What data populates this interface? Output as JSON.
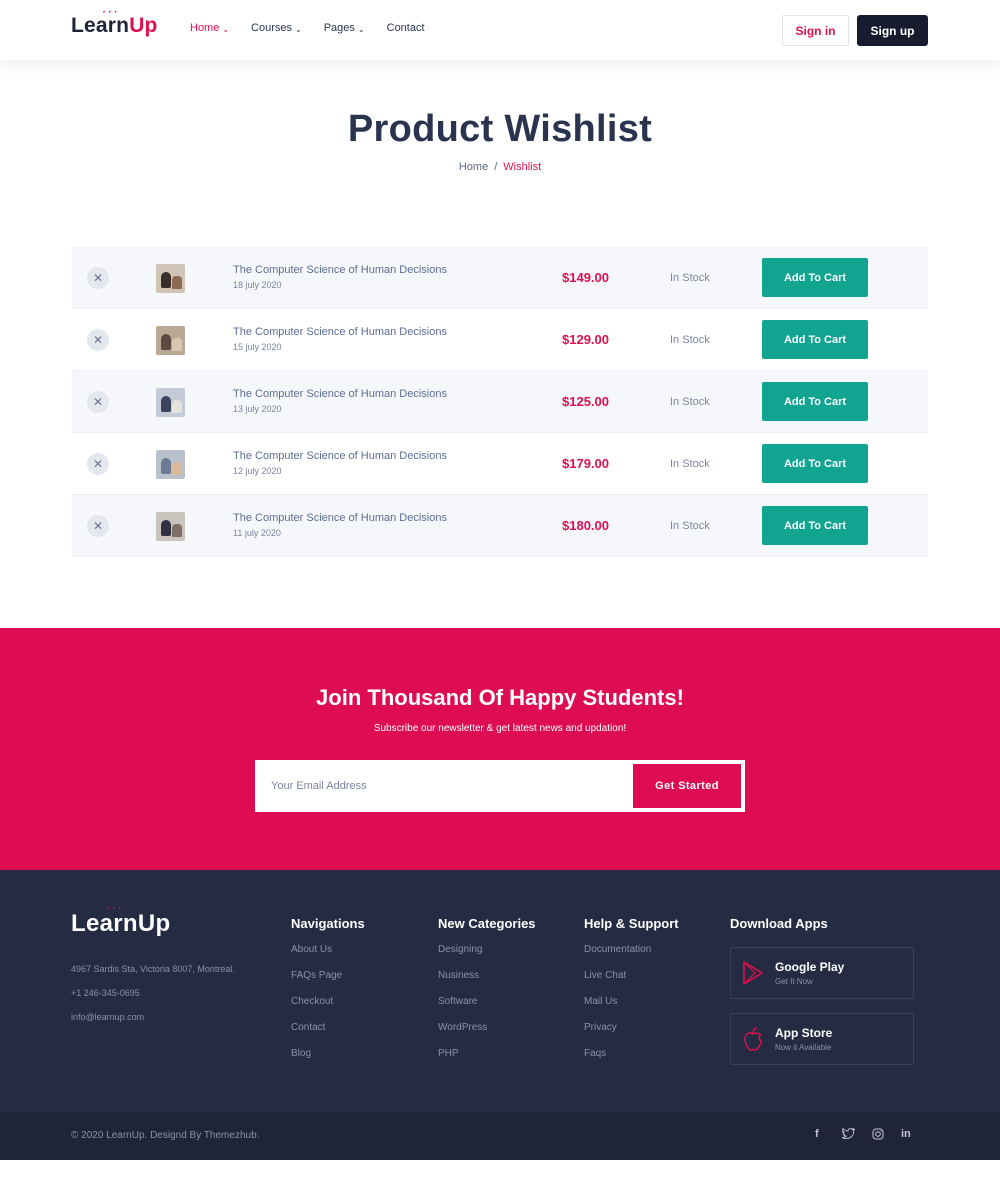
{
  "brand": {
    "name_part1": "Learn",
    "name_part2": "Up",
    "accent": "#e0104f"
  },
  "nav": {
    "items": [
      {
        "label": "Home",
        "has_dropdown": true,
        "active": true
      },
      {
        "label": "Courses",
        "has_dropdown": true,
        "active": false
      },
      {
        "label": "Pages",
        "has_dropdown": true,
        "active": false
      },
      {
        "label": "Contact",
        "has_dropdown": false,
        "active": false
      }
    ],
    "signin_label": "Sign in",
    "signup_label": "Sign up"
  },
  "page": {
    "title": "Product Wishlist",
    "breadcrumb": {
      "home": "Home",
      "separator": "/",
      "current": "Wishlist"
    }
  },
  "wishlist": {
    "rows": [
      {
        "title": "The Computer Science of Human Decisions",
        "date": "18 july 2020",
        "price": "$149.00",
        "stock": "In Stock",
        "button": "Add To Cart"
      },
      {
        "title": "The Computer Science of Human Decisions",
        "date": "15 july 2020",
        "price": "$129.00",
        "stock": "In Stock",
        "button": "Add To Cart"
      },
      {
        "title": "The Computer Science of Human Decisions",
        "date": "13 july 2020",
        "price": "$125.00",
        "stock": "In Stock",
        "button": "Add To Cart"
      },
      {
        "title": "The Computer Science of Human Decisions",
        "date": "12 july 2020",
        "price": "$179.00",
        "stock": "In Stock",
        "button": "Add To Cart"
      },
      {
        "title": "The Computer Science of Human Decisions",
        "date": "11 july 2020",
        "price": "$180.00",
        "stock": "In Stock",
        "button": "Add To Cart"
      }
    ],
    "remove_icon": "close-icon"
  },
  "newsletter": {
    "title": "Join Thousand Of Happy Students!",
    "subtitle": "Subscribe our newsletter & get latest news and updation!",
    "placeholder": "Your Email Address",
    "button": "Get Started",
    "background": "#de0c52"
  },
  "footer": {
    "address": "4967 Sardis Sta, Victoria 8007, Montreal.",
    "phone": "+1 246-345-0695",
    "email": "info@learnup.com",
    "columns": [
      {
        "heading": "Navigations",
        "links": [
          "About Us",
          "FAQs Page",
          "Checkout",
          "Contact",
          "Blog"
        ]
      },
      {
        "heading": "New Categories",
        "links": [
          "Designing",
          "Nusiness",
          "Software",
          "WordPress",
          "PHP"
        ]
      },
      {
        "heading": "Help & Support",
        "links": [
          "Documentation",
          "Live Chat",
          "Mail Us",
          "Privacy",
          "Faqs"
        ]
      }
    ],
    "apps_heading": "Download Apps",
    "apps": [
      {
        "name": "Google Play",
        "sub": "Get It Now",
        "icon": "google-play-icon"
      },
      {
        "name": "App Store",
        "sub": "Now it Available",
        "icon": "apple-icon"
      }
    ],
    "copyright": "© 2020 LearnUp. Designd By Themezhub.",
    "social": [
      "f",
      "t",
      "ig",
      "in"
    ],
    "background": "#252b42"
  }
}
